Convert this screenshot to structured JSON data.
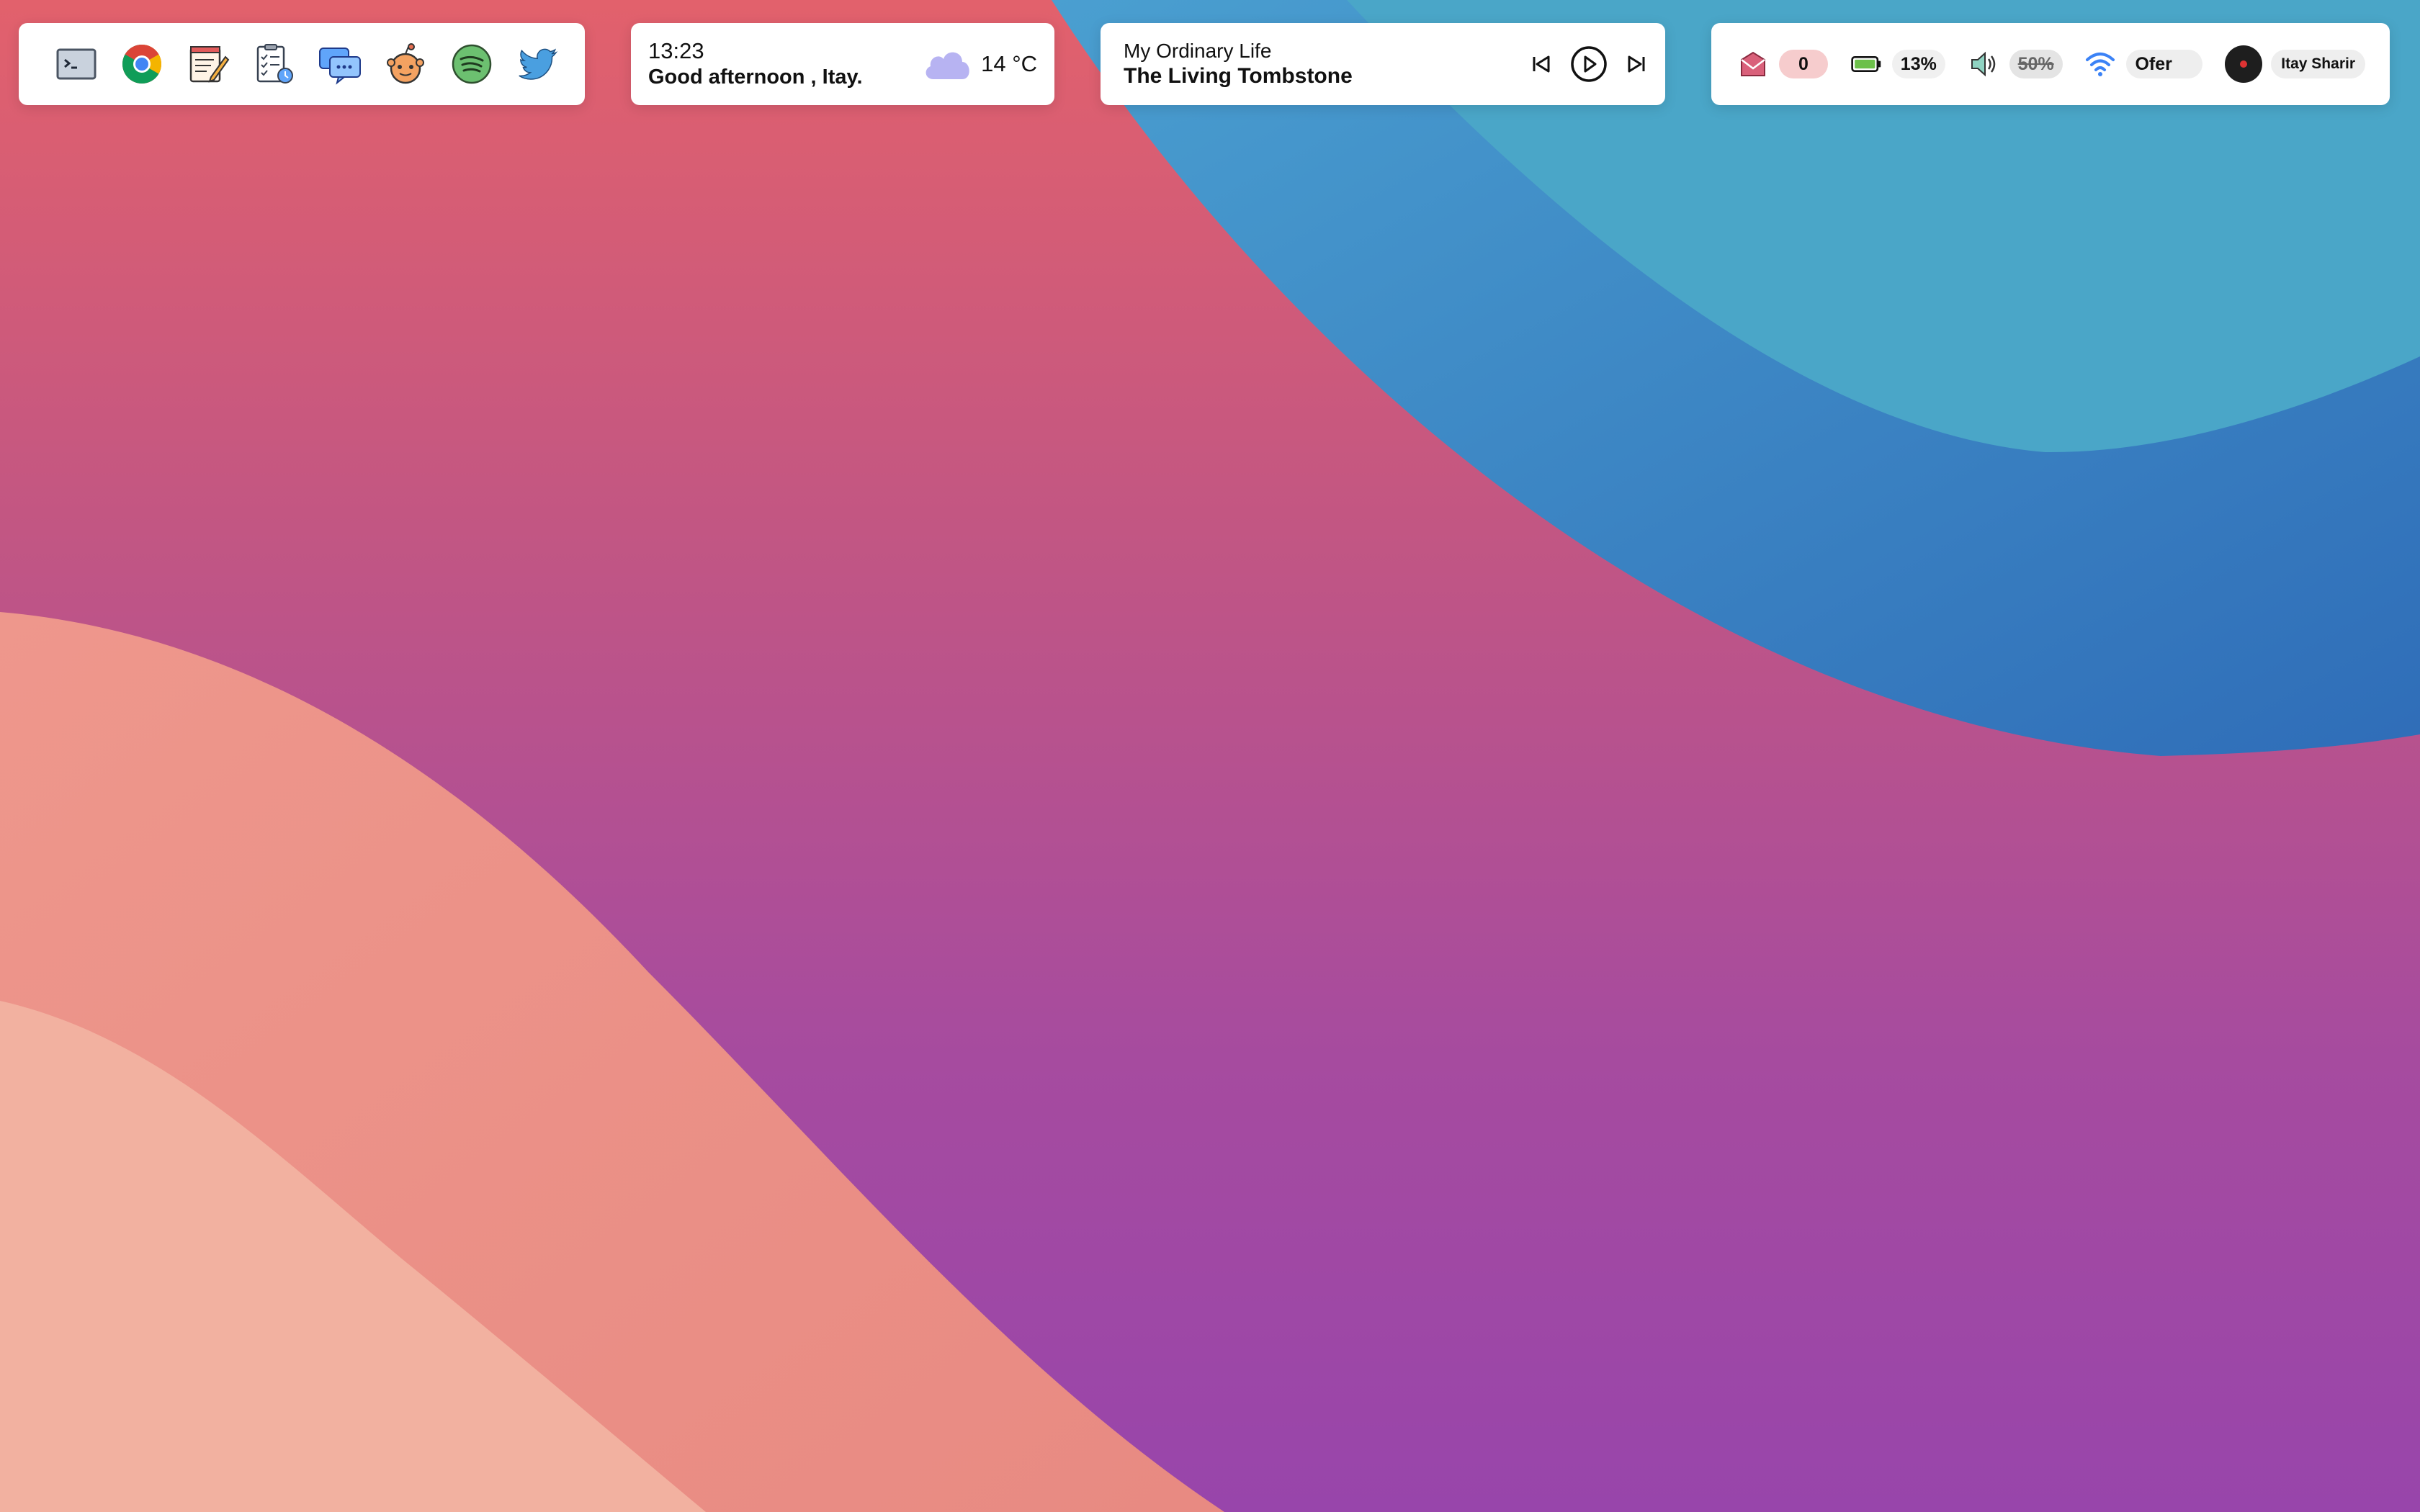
{
  "theme": {
    "wallpaper_red": "#e2616c",
    "wallpaper_purple": "#9845ab",
    "wallpaper_blue": "#4aa6c8",
    "wallpaper_blue_dark": "#3a7fc4",
    "wallpaper_peach": "#ea8f86",
    "wallpaper_light_peach": "#f2b1a0",
    "panel_bg": "#ffffff"
  },
  "launcher": {
    "apps": [
      {
        "name": "terminal",
        "icon": "terminal-icon"
      },
      {
        "name": "chrome",
        "icon": "chrome-icon"
      },
      {
        "name": "notes",
        "icon": "notepad-pencil-icon"
      },
      {
        "name": "tasks",
        "icon": "checklist-clock-icon"
      },
      {
        "name": "chat",
        "icon": "chat-bubbles-icon"
      },
      {
        "name": "reddit",
        "icon": "reddit-icon"
      },
      {
        "name": "spotify",
        "icon": "spotify-icon"
      },
      {
        "name": "twitter",
        "icon": "twitter-bird-icon"
      }
    ]
  },
  "clock": {
    "time": "13:23",
    "greeting": "Good afternoon , Itay."
  },
  "weather": {
    "icon": "cloud-icon",
    "temperature": "14 °C"
  },
  "player": {
    "song": "My Ordinary Life",
    "artist": "The Living Tombstone",
    "controls": [
      "previous-icon",
      "play-icon",
      "next-icon"
    ]
  },
  "tray": {
    "mail": {
      "icon": "mail-icon",
      "count": "0"
    },
    "battery": {
      "icon": "battery-icon",
      "level": "13%"
    },
    "volume": {
      "icon": "speaker-icon",
      "level": "50%"
    },
    "wifi": {
      "icon": "wifi-icon",
      "network": "Ofer"
    },
    "user": {
      "name": "Itay Sharir"
    }
  }
}
